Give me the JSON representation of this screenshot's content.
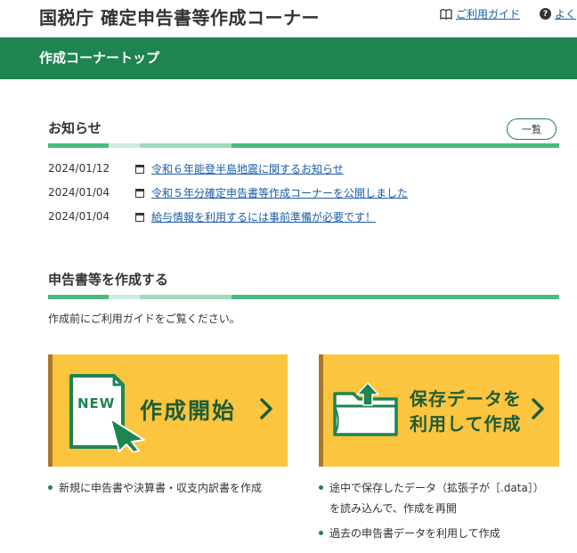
{
  "header": {
    "site_title": "国税庁 確定申告書等作成コーナー",
    "guide_label": "ご利用ガイド",
    "faq_label": "よく"
  },
  "greenbar": {
    "title": "作成コーナートップ"
  },
  "news": {
    "title": "お知らせ",
    "list_button": "一覧",
    "items": [
      {
        "date": "2024/01/12",
        "text": "令和６年能登半島地震に関するお知らせ"
      },
      {
        "date": "2024/01/04",
        "text": "令和５年分確定申告書等作成コーナーを公開しました"
      },
      {
        "date": "2024/01/04",
        "text": "給与情報を利用するには事前準備が必要です！"
      }
    ]
  },
  "create": {
    "title": "申告書等を作成する",
    "note": "作成前にご利用ガイドをご覧ください。",
    "start_card": {
      "badge": "NEW",
      "label": "作成開始",
      "bullets": [
        "新規に申告書や決算書・収支内訳書を作成"
      ]
    },
    "saved_card": {
      "label_line1": "保存データを",
      "label_line2": "利用して作成",
      "bullets": [
        "途中で保存したデータ（拡張子が［.data］）",
        "を読み込んで、作成を再開",
        "過去の申告書データを利用して作成"
      ]
    }
  },
  "colors": {
    "brand_green": "#1e8450",
    "card_yellow": "#fcc53f",
    "card_border": "#a8782a",
    "link_blue": "#1a5ca6"
  }
}
